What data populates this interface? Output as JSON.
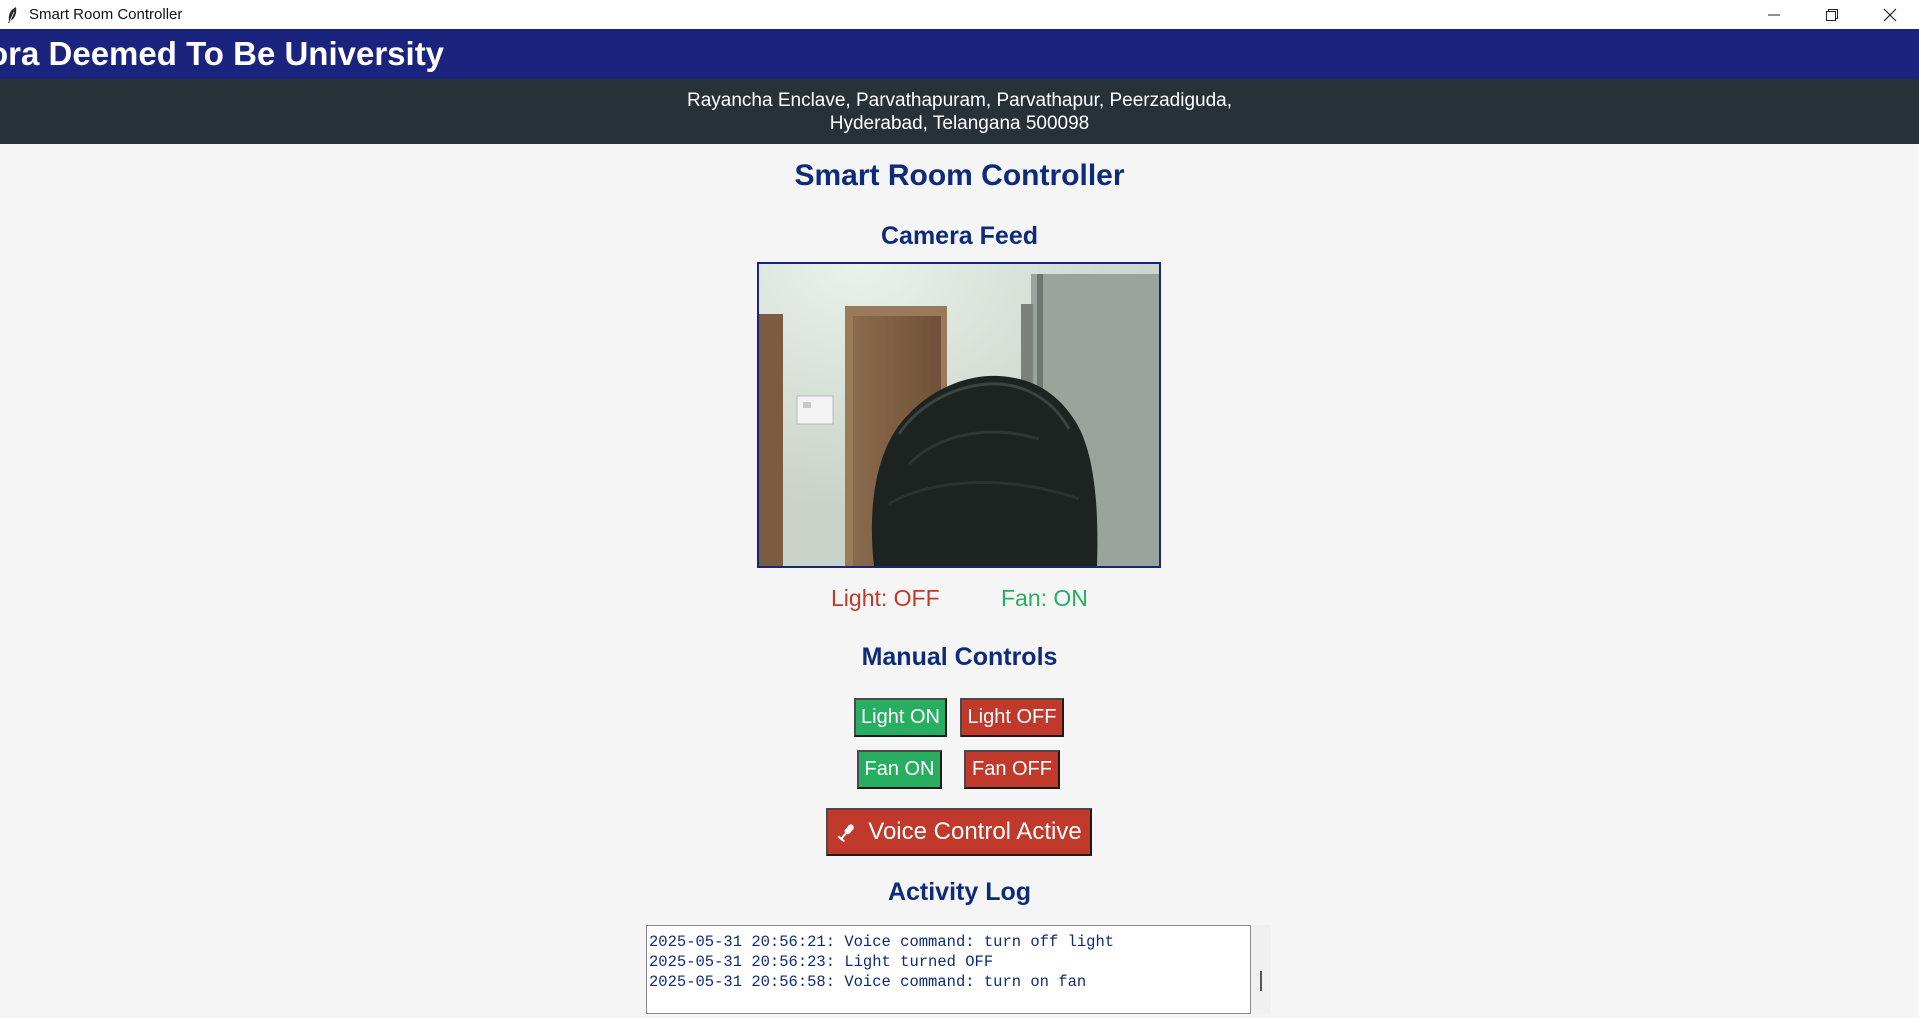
{
  "window": {
    "title": "Smart Room Controller",
    "controls": [
      "minimize",
      "restore",
      "close"
    ]
  },
  "banner": {
    "text": "ora Deemed To Be University"
  },
  "address": {
    "line1": "Rayancha Enclave, Parvathapuram, Parvathapur, Peerzadiguda,",
    "line2": "Hyderabad, Telangana 500098"
  },
  "main": {
    "title": "Smart Room Controller",
    "camera_title": "Camera Feed",
    "status": {
      "light": "Light: OFF",
      "fan": "Fan: ON"
    },
    "manual_title": "Manual Controls",
    "buttons": {
      "light_on": "Light ON",
      "light_off": "Light OFF",
      "fan_on": "Fan ON",
      "fan_off": "Fan OFF"
    },
    "voice_button": "Voice Control Active",
    "log_title": "Activity Log",
    "log": [
      "2025-05-31 20:56:21: Voice command: turn off light",
      "2025-05-31 20:56:23: Light turned OFF",
      "2025-05-31 20:56:58: Voice command: turn on fan"
    ]
  },
  "colors": {
    "banner_bg": "#1a237e",
    "address_bg": "#263238",
    "heading": "#0d2b7a",
    "green": "#27ae60",
    "red": "#c0392b"
  }
}
